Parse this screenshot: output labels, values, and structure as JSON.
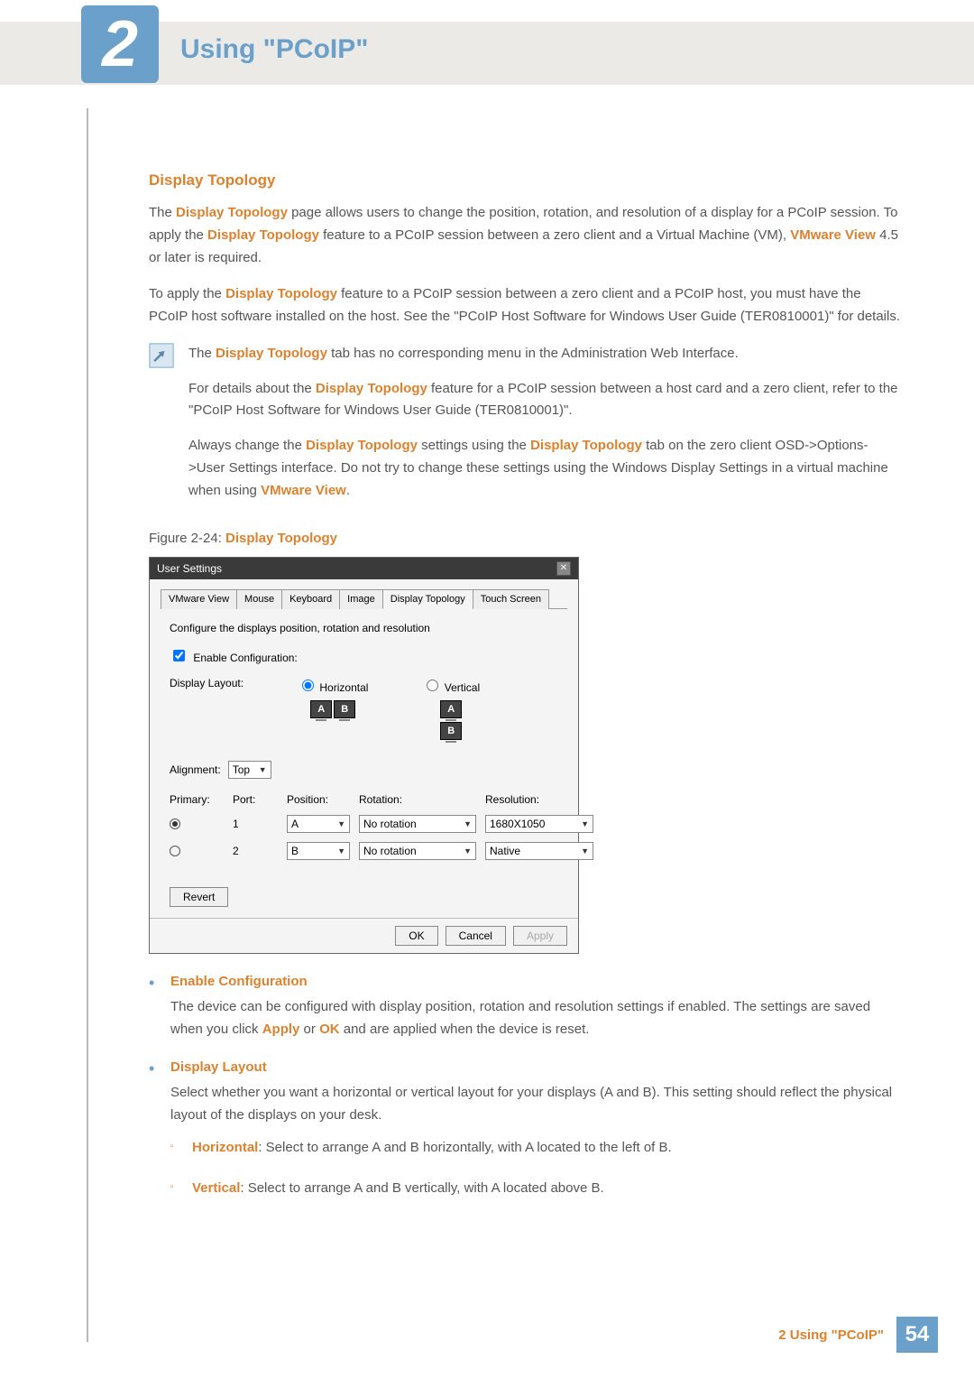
{
  "chapter": {
    "number": "2",
    "title": "Using \"PCoIP\""
  },
  "section": {
    "title": "Display Topology"
  },
  "para1": {
    "t1": "The ",
    "em1": "Display Topology",
    "t2": " page allows users to change the position, rotation, and resolution of a display for a PCoIP session. To apply the ",
    "em2": "Display Topology",
    "t3": " feature to a PCoIP session between a zero client and a Virtual Machine (VM), ",
    "em3": "VMware View",
    "t4": " 4.5 or later is required."
  },
  "para2": {
    "t1": "To apply the ",
    "em1": "Display Topology",
    "t2": " feature to a PCoIP session between a zero client and a PCoIP host, you must have the PCoIP host software installed on the host. See the \"PCoIP Host Software for Windows User Guide (TER0810001)\" for details."
  },
  "note": {
    "p1": {
      "t1": "The ",
      "em1": "Display Topology",
      "t2": " tab has no corresponding menu in the Administration Web Interface."
    },
    "p2": {
      "t1": "For details about the ",
      "em1": "Display Topology",
      "t2": " feature for a PCoIP session between a host card and a zero client, refer to the \"PCoIP Host Software for Windows User Guide (TER0810001)\"."
    },
    "p3": {
      "t1": "Always change the ",
      "em1": "Display Topology",
      "t2": " settings using the ",
      "em2": "Display Topology",
      "t3": " tab on the zero client OSD->Options->User Settings interface. Do not try to change these settings using the Windows Display Settings in a virtual machine when using ",
      "em3": "VMware View",
      "t4": "."
    }
  },
  "figure": {
    "prefix": "Figure 2-24: ",
    "name": "Display Topology"
  },
  "dialog": {
    "title": "User Settings",
    "tabs": [
      "VMware View",
      "Mouse",
      "Keyboard",
      "Image",
      "Display Topology",
      "Touch Screen"
    ],
    "active_tab": 4,
    "intro": "Configure the displays position, rotation and resolution",
    "enable_label": "Enable Configuration:",
    "layout_label": "Display Layout:",
    "layout_horizontal": "Horizontal",
    "layout_vertical": "Vertical",
    "mon_a": "A",
    "mon_b": "B",
    "alignment_label": "Alignment:",
    "alignment_value": "Top",
    "headers": {
      "primary": "Primary:",
      "port": "Port:",
      "position": "Position:",
      "rotation": "Rotation:",
      "resolution": "Resolution:"
    },
    "rows": [
      {
        "primary": true,
        "port": "1",
        "position": "A",
        "rotation": "No rotation",
        "resolution": "1680X1050"
      },
      {
        "primary": false,
        "port": "2",
        "position": "B",
        "rotation": "No rotation",
        "resolution": "Native"
      }
    ],
    "revert": "Revert",
    "ok": "OK",
    "cancel": "Cancel",
    "apply": "Apply"
  },
  "definitions": {
    "enable": {
      "title": "Enable Configuration",
      "t1": "The device can be configured with display position, rotation and resolution settings if enabled. The settings are saved when you click ",
      "em1": "Apply",
      "t2": " or ",
      "em2": "OK",
      "t3": " and are applied when the device is reset."
    },
    "layout": {
      "title": "Display Layout",
      "desc": "Select whether you want a horizontal or vertical layout for your displays (A and B). This setting should reflect the physical layout of the displays on your desk.",
      "h": {
        "em": "Horizontal",
        "t": ": Select to arrange A and B horizontally, with A located to the left of B."
      },
      "v": {
        "em": "Vertical",
        "t": ": Select to arrange A and B vertically, with A located above B."
      }
    }
  },
  "footer": {
    "text": "2 Using \"PCoIP\"",
    "page": "54"
  }
}
